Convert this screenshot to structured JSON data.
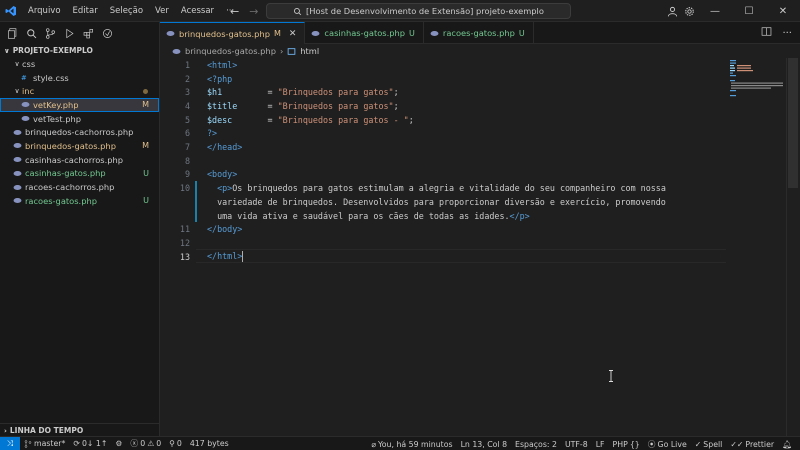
{
  "menu": [
    "Arquivo",
    "Editar",
    "Seleção",
    "Ver",
    "Acessar",
    "···"
  ],
  "search": {
    "text": "[Host de Desenvolvimento de Extensão] projeto-exemplo"
  },
  "explorer": {
    "root": "PROJETO-EXEMPLO",
    "items": [
      {
        "label": "css",
        "type": "folder",
        "indent": 1,
        "status": "plain"
      },
      {
        "label": "style.css",
        "type": "css",
        "indent": 2,
        "status": "plain"
      },
      {
        "label": "inc",
        "type": "folder",
        "indent": 1,
        "status": "mod",
        "dot": true
      },
      {
        "label": "vetKey.php",
        "type": "php",
        "indent": 2,
        "status": "mod",
        "badge": "M",
        "active": true
      },
      {
        "label": "vetTest.php",
        "type": "php",
        "indent": 2,
        "status": "plain"
      },
      {
        "label": "brinquedos-cachorros.php",
        "type": "php",
        "indent": 1,
        "status": "plain"
      },
      {
        "label": "brinquedos-gatos.php",
        "type": "php",
        "indent": 1,
        "status": "mod",
        "badge": "M"
      },
      {
        "label": "casinhas-cachorros.php",
        "type": "php",
        "indent": 1,
        "status": "plain"
      },
      {
        "label": "casinhas-gatos.php",
        "type": "php",
        "indent": 1,
        "status": "untracked",
        "badge": "U"
      },
      {
        "label": "racoes-cachorros.php",
        "type": "php",
        "indent": 1,
        "status": "plain"
      },
      {
        "label": "racoes-gatos.php",
        "type": "php",
        "indent": 1,
        "status": "untracked",
        "badge": "U"
      }
    ],
    "timeline": "LINHA DO TEMPO"
  },
  "tabs": [
    {
      "label": "brinquedos-gatos.php",
      "flag": "M",
      "status": "mod",
      "active": true
    },
    {
      "label": "casinhas-gatos.php",
      "flag": "U",
      "status": "untracked"
    },
    {
      "label": "racoes-gatos.php",
      "flag": "U",
      "status": "untracked"
    }
  ],
  "breadcrumb": {
    "file": "brinquedos-gatos.php",
    "symbol": "html"
  },
  "code": {
    "lines": [
      {
        "n": "1",
        "tokens": [
          [
            "k-tag",
            "<html>"
          ]
        ]
      },
      {
        "n": "2",
        "tokens": [
          [
            "k-php",
            "<?php"
          ]
        ]
      },
      {
        "n": "3",
        "tokens": [
          [
            "k-var",
            "$h1"
          ],
          [
            "k-txt",
            "         = "
          ],
          [
            "k-str",
            "\"Brinquedos para gatos\""
          ],
          [
            "k-txt",
            ";"
          ]
        ]
      },
      {
        "n": "4",
        "tokens": [
          [
            "k-var",
            "$title"
          ],
          [
            "k-txt",
            "      = "
          ],
          [
            "k-str",
            "\"Brinquedos para gatos\""
          ],
          [
            "k-txt",
            ";"
          ]
        ]
      },
      {
        "n": "5",
        "tokens": [
          [
            "k-var",
            "$desc"
          ],
          [
            "k-txt",
            "       = "
          ],
          [
            "k-str",
            "\"Brinquedos para gatos - \""
          ],
          [
            "k-txt",
            ";"
          ]
        ]
      },
      {
        "n": "6",
        "tokens": [
          [
            "k-php",
            "?>"
          ]
        ]
      },
      {
        "n": "7",
        "tokens": [
          [
            "k-tag",
            "</head>"
          ]
        ]
      },
      {
        "n": "8",
        "tokens": []
      },
      {
        "n": "9",
        "tokens": [
          [
            "k-tag",
            "<body>"
          ]
        ]
      },
      {
        "n": "10",
        "tokens": [
          [
            "k-txt",
            "  "
          ],
          [
            "k-tag",
            "<p>"
          ],
          [
            "k-txt",
            "Os brinquedos para gatos estimulam a alegria e vitalidade do seu companheiro com nossa"
          ]
        ]
      },
      {
        "n": "",
        "tokens": [
          [
            "k-txt",
            "  variedade de brinquedos. Desenvolvidos para proporcionar diversão e exercício, promovendo"
          ]
        ]
      },
      {
        "n": "",
        "tokens": [
          [
            "k-txt",
            "  uma vida ativa e saudável para os cães de todas as idades."
          ],
          [
            "k-tag",
            "</p>"
          ]
        ]
      },
      {
        "n": "11",
        "tokens": [
          [
            "k-tag",
            "</body>"
          ]
        ]
      },
      {
        "n": "12",
        "tokens": []
      },
      {
        "n": "13",
        "tokens": [
          [
            "k-tag",
            "</html>"
          ]
        ],
        "current": true
      }
    ]
  },
  "status": {
    "branch": "master*",
    "sync": "0↓ 1↑",
    "problems_errors": "0",
    "problems_warnings": "0",
    "ports": "0",
    "size": "417 bytes",
    "blame": "You, há 59 minutos",
    "position": "Ln 13, Col 8",
    "spaces": "Espaços: 2",
    "encoding": "UTF-8",
    "eol": "LF",
    "language": "PHP",
    "golive": "Go Live",
    "spell": "Spell",
    "prettier": "Prettier"
  },
  "colors": {
    "accent": "#0078d4",
    "modified": "#e2c08d",
    "untracked": "#73c991"
  }
}
